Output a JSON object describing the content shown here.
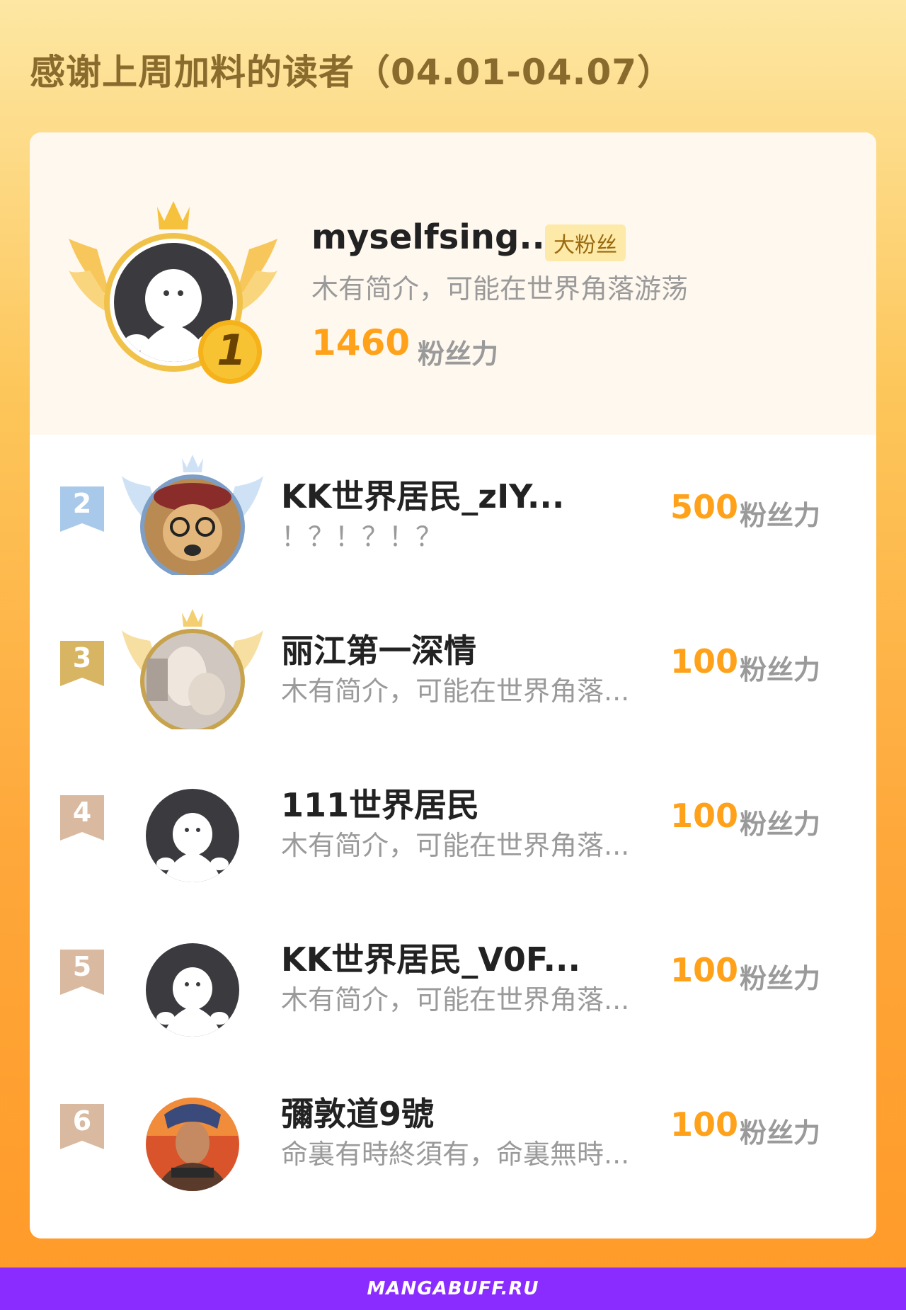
{
  "header": {
    "title": "感谢上周加料的读者（04.01-04.07）"
  },
  "colors": {
    "accent": "#ffa21a",
    "rank2": "#a9c9ea",
    "rank3": "#d8b563",
    "rank_other": "#d9b9a0",
    "footer": "#8a2cff"
  },
  "top_reader": {
    "rank": "1",
    "name": "myselfsing...",
    "badge": "大粉丝",
    "bio": "木有简介，可能在世界角落游荡",
    "score": "1460",
    "unit": "粉丝力",
    "avatar": "default-ghost-avatar"
  },
  "readers": [
    {
      "rank": "2",
      "name": "KK世界居民_zIY...",
      "bio": "！？！？！？",
      "score": "500",
      "unit": "粉丝力",
      "avatar": "dog-with-glasses-avatar"
    },
    {
      "rank": "3",
      "name": "丽江第一深情",
      "bio": "木有简介，可能在世界角落...",
      "score": "100",
      "unit": "粉丝力",
      "avatar": "cat-photo-avatar"
    },
    {
      "rank": "4",
      "name": "111世界居民",
      "bio": "木有简介，可能在世界角落...",
      "score": "100",
      "unit": "粉丝力",
      "avatar": "default-ghost-avatar"
    },
    {
      "rank": "5",
      "name": "KK世界居民_V0F...",
      "bio": "木有简介，可能在世界角落...",
      "score": "100",
      "unit": "粉丝力",
      "avatar": "default-ghost-avatar"
    },
    {
      "rank": "6",
      "name": "彌敦道9號",
      "bio": "命裏有時終須有，命裏無時...",
      "score": "100",
      "unit": "粉丝力",
      "avatar": "man-portrait-avatar"
    }
  ],
  "footer": {
    "text": "MANGABUFF.RU"
  }
}
